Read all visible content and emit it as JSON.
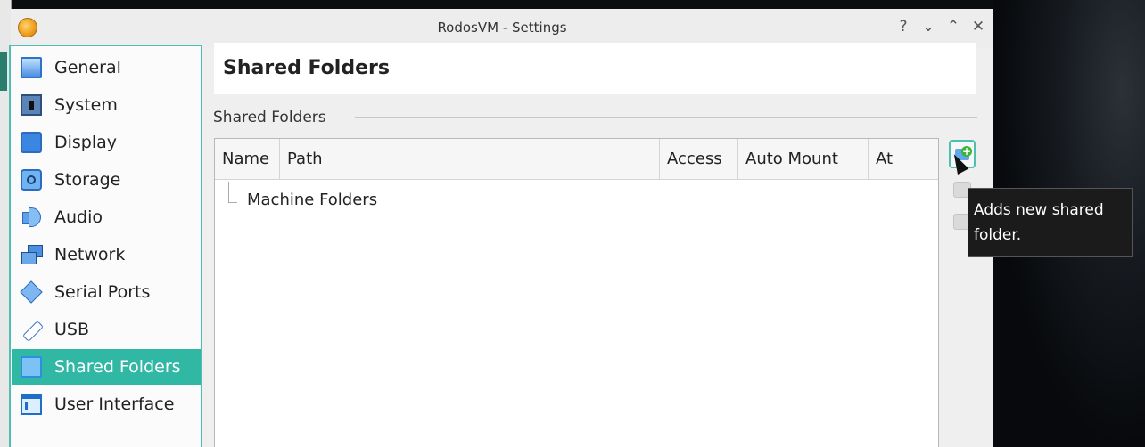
{
  "window": {
    "title": "RodosVM - Settings"
  },
  "window_controls": {
    "help": "?",
    "minimize": "⌄",
    "maximize": "⌃",
    "close": "✕"
  },
  "sidebar": {
    "items": [
      {
        "label": "General",
        "icon": "general-icon"
      },
      {
        "label": "System",
        "icon": "system-icon"
      },
      {
        "label": "Display",
        "icon": "display-icon"
      },
      {
        "label": "Storage",
        "icon": "storage-icon"
      },
      {
        "label": "Audio",
        "icon": "audio-icon"
      },
      {
        "label": "Network",
        "icon": "network-icon"
      },
      {
        "label": "Serial Ports",
        "icon": "serial-ports-icon"
      },
      {
        "label": "USB",
        "icon": "usb-icon"
      },
      {
        "label": "Shared Folders",
        "icon": "shared-folders-icon",
        "active": true
      },
      {
        "label": "User Interface",
        "icon": "user-interface-icon"
      }
    ]
  },
  "page": {
    "title": "Shared Folders"
  },
  "group": {
    "label": "Shared Folders"
  },
  "table": {
    "columns": [
      "Name",
      "Path",
      "Access",
      "Auto Mount",
      "At"
    ],
    "rows": [
      {
        "name": "Machine Folders"
      }
    ]
  },
  "tooltip": {
    "line1": "Adds new shared",
    "line2": "folder."
  },
  "colors": {
    "accent": "#30b8a5",
    "selection_text": "#ffffff"
  }
}
